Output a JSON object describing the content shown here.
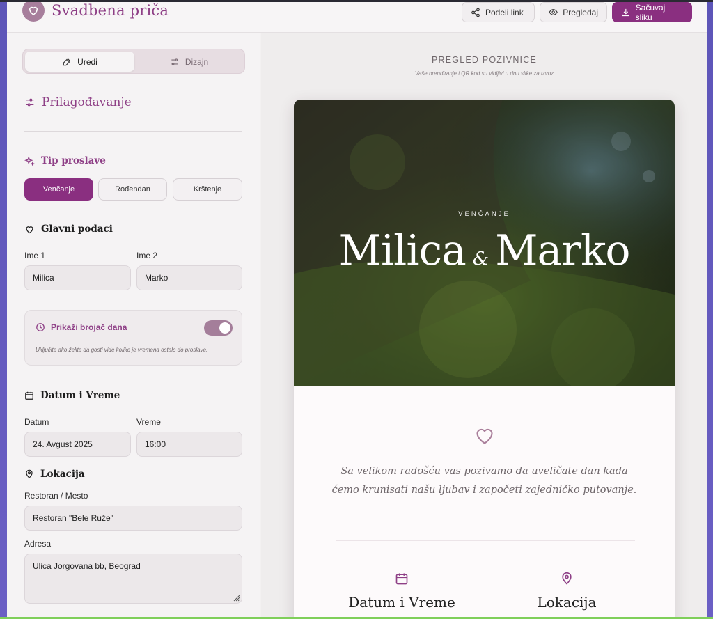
{
  "colors": {
    "brand": "#8a2f80",
    "toggle": "#a47e9a"
  },
  "header": {
    "title": "Svadbena priča",
    "share_label": "Podeli link",
    "preview_label": "Pregledaj",
    "save_label": "Sačuvaj sliku"
  },
  "sidebar": {
    "tabs": [
      {
        "label": "Uredi",
        "icon": "palette-icon",
        "active": true
      },
      {
        "label": "Dizajn",
        "icon": "sliders-icon",
        "active": false
      }
    ],
    "customize_title": "Prilagođavanje",
    "event_type": {
      "title": "Tip proslave",
      "options": [
        "Venčanje",
        "Rođendan",
        "Krštenje"
      ],
      "selected": "Venčanje"
    },
    "main_info": {
      "title": "Glavni podaci",
      "name1_label": "Ime 1",
      "name1_value": "Milica",
      "name2_label": "Ime 2",
      "name2_value": "Marko"
    },
    "countdown": {
      "label": "Prikaži brojač dana",
      "enabled": true,
      "help": "Uključite ako želite da gosti vide koliko je vremena ostalo do proslave."
    },
    "datetime": {
      "title": "Datum i Vreme",
      "date_label": "Datum",
      "date_value": "24. Avgust 2025",
      "time_label": "Vreme",
      "time_value": "16:00"
    },
    "location": {
      "title": "Lokacija",
      "venue_label": "Restoran / Mesto",
      "venue_value": "Restoran \"Bele Ruže\"",
      "address_label": "Adresa",
      "address_value": "Ulica Jorgovana bb, Beograd"
    }
  },
  "preview": {
    "title": "PREGLED POZIVNICE",
    "subtitle": "Vaše brendiranje i QR kod su vidljivi u dnu slike za izvoz",
    "event_label": "VENČANJE",
    "name1": "Milica",
    "amp": "&",
    "name2": "Marko",
    "message_line1": "Sa velikom radošću vas pozivamo da uveličate dan kada",
    "message_line2": "ćemo krunisati našu ljubav i započeti zajedničko putovanje.",
    "col1_title": "Datum i Vreme",
    "col2_title": "Lokacija"
  }
}
